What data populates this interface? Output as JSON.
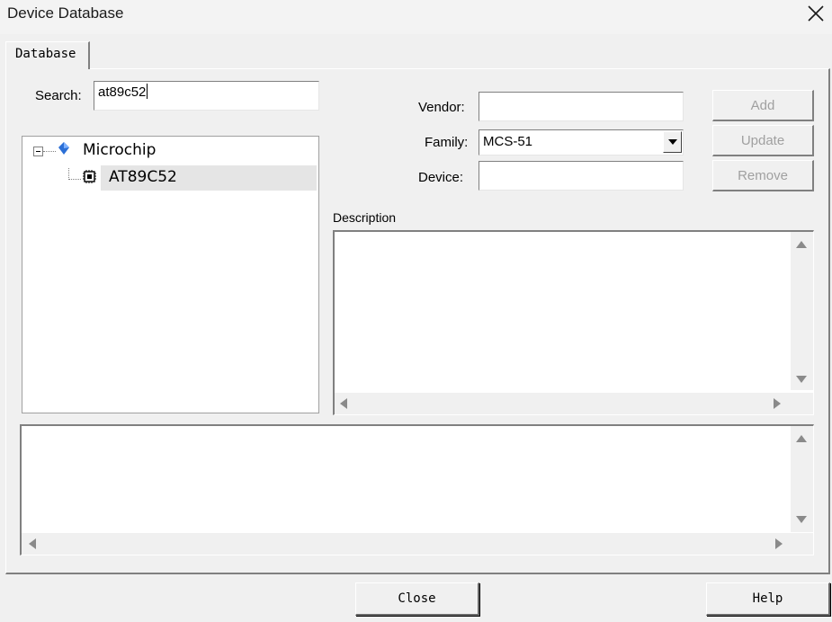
{
  "window": {
    "title": "Device Database"
  },
  "tabs": [
    {
      "label": "Database"
    }
  ],
  "search": {
    "label": "Search:",
    "value": "at89c52"
  },
  "tree": {
    "vendor": {
      "label": "Microchip"
    },
    "device": {
      "label": "AT89C52"
    }
  },
  "fields": {
    "vendor_label": "Vendor:",
    "vendor_value": "",
    "family_label": "Family:",
    "family_value": "MCS-51",
    "device_label": "Device:",
    "device_value": ""
  },
  "buttons": {
    "add": "Add",
    "update": "Update",
    "remove": "Remove",
    "close": "Close",
    "help": "Help"
  },
  "description": {
    "label": "Description",
    "value": ""
  },
  "notes": {
    "value": ""
  },
  "icons": {
    "window_close": "close-icon",
    "tree_collapse": "minus-box-icon",
    "vendor": "blue-diamond-icon",
    "device": "chip-icon",
    "combo": "chevron-down-icon"
  },
  "colors": {
    "tree_selection": "#e5e5e5",
    "title_bar": "#f3f3f3",
    "dialog_bg": "#f0f0f0"
  }
}
